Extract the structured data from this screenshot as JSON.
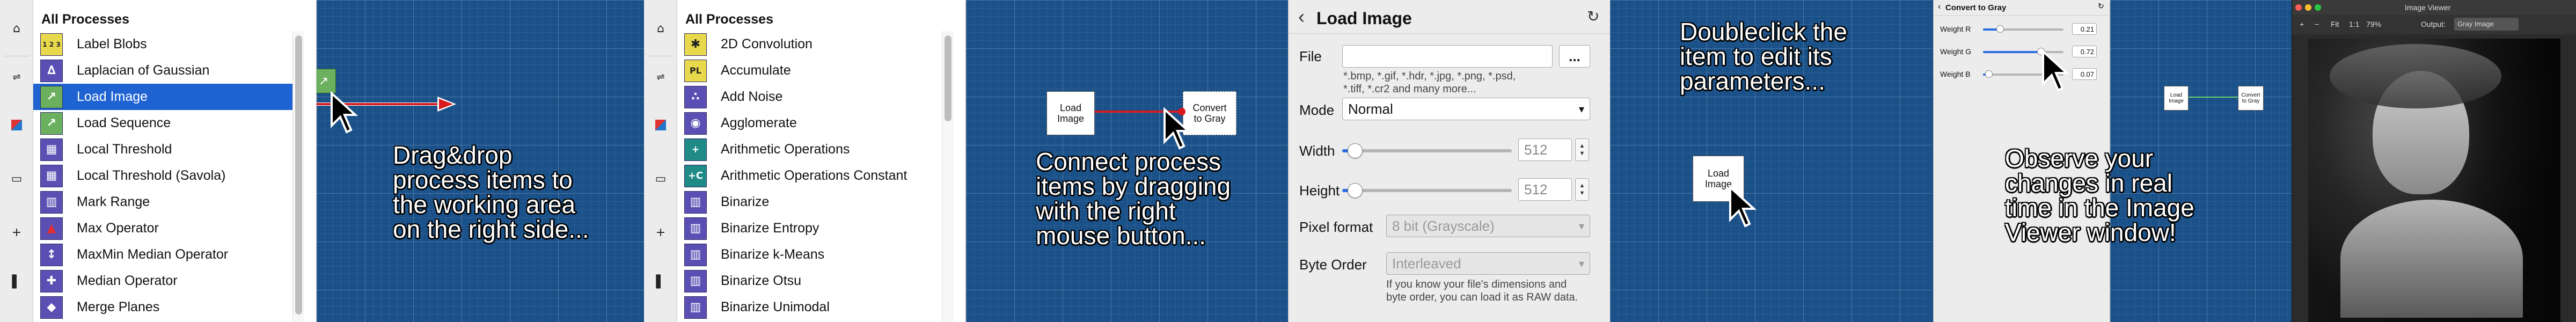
{
  "panel1": {
    "header": "All Processes",
    "items": [
      {
        "label": "Label Blobs",
        "icon": "1 2 3"
      },
      {
        "label": "Laplacian of Gaussian",
        "icon": "∆"
      },
      {
        "label": "Load Image",
        "icon": "↗"
      },
      {
        "label": "Load Sequence",
        "icon": "↗"
      },
      {
        "label": "Local Threshold",
        "icon": "▦"
      },
      {
        "label": "Local Threshold (Savola)",
        "icon": "▦"
      },
      {
        "label": "Mark Range",
        "icon": "▥"
      },
      {
        "label": "Max Operator",
        "icon": "▲"
      },
      {
        "label": "MaxMin Median Operator",
        "icon": "↕"
      },
      {
        "label": "Median Operator",
        "icon": "✚"
      },
      {
        "label": "Merge Planes",
        "icon": "◆"
      }
    ],
    "selected_index": 2,
    "annotation": [
      "Drag&drop",
      "process items to",
      "the working area",
      "on the right side..."
    ]
  },
  "panel2": {
    "header": "All Processes",
    "items": [
      {
        "label": "2D Convolution",
        "icon": "✱"
      },
      {
        "label": "Accumulate",
        "icon": "PL"
      },
      {
        "label": "Add Noise",
        "icon": "∴"
      },
      {
        "label": "Agglomerate",
        "icon": "◉"
      },
      {
        "label": "Arithmetic Operations",
        "icon": "+"
      },
      {
        "label": "Arithmetic Operations Constant",
        "icon": "+C"
      },
      {
        "label": "Binarize",
        "icon": "▥"
      },
      {
        "label": "Binarize Entropy",
        "icon": "▥"
      },
      {
        "label": "Binarize k-Means",
        "icon": "▥"
      },
      {
        "label": "Binarize Otsu",
        "icon": "▥"
      },
      {
        "label": "Binarize Unimodal",
        "icon": "▥"
      }
    ],
    "node_a": "Load Image",
    "node_b": "Convert to Gray",
    "annotation": [
      "Connect process",
      "items by dragging",
      "with the right",
      "mouse button..."
    ]
  },
  "panel3": {
    "title": "Load Image",
    "back": "‹",
    "reset": "↻",
    "file_label": "File",
    "file_value": "",
    "browse": "...",
    "file_hint": [
      "*.bmp, *.gif, *.hdr, *.jpg, *.png, *.psd,",
      "*.tiff, *.cr2 and many more..."
    ],
    "mode_label": "Mode",
    "mode_value": "Normal",
    "width_label": "Width",
    "width_value": "512",
    "height_label": "Height",
    "height_value": "512",
    "format_label": "Pixel format",
    "format_value": "8 bit (Grayscale)",
    "order_label": "Byte Order",
    "order_value": "Interleaved",
    "order_hint": [
      "If you know your file's dimensions and",
      "byte order, you can load it as RAW data."
    ]
  },
  "panel4": {
    "node": "Load Image",
    "annotation": [
      "Doubleclick the",
      "item to edit its",
      "parameters..."
    ],
    "params_title": "Convert to Gray",
    "params": [
      {
        "label": "Weight R",
        "value": "0.21",
        "fraction": 0.21
      },
      {
        "label": "Weight G",
        "value": "0.72",
        "fraction": 0.72
      },
      {
        "label": "Weight B",
        "value": "0.07",
        "fraction": 0.07
      }
    ]
  },
  "panel5": {
    "annotation": [
      "Observe your",
      "changes in real",
      "time in the Image",
      "Viewer window!"
    ],
    "node_a": "Load Image",
    "node_b": "Convert to Gray",
    "viewer_title": "Image Viewer",
    "zoom_fit": "Fit",
    "zoom_one": "1:1",
    "zoom_pct": "79%",
    "output_label": "Output:",
    "output_value": "Gray Image"
  }
}
